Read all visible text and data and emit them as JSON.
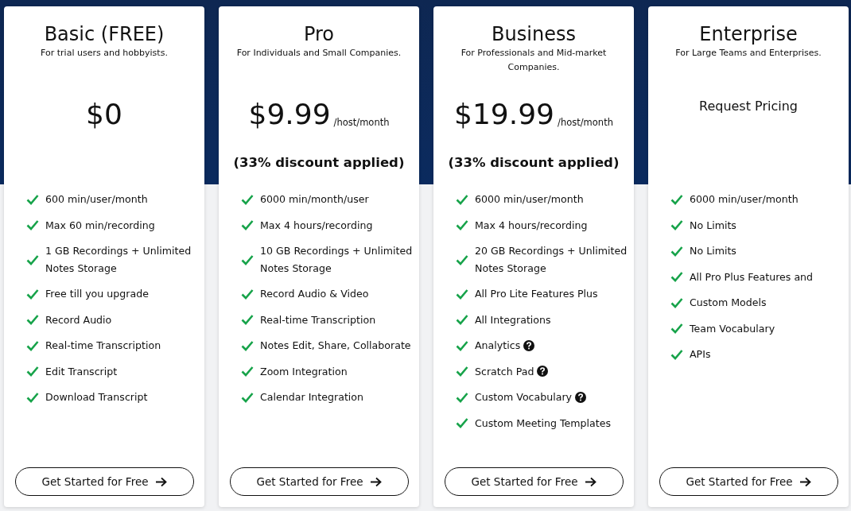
{
  "plans": [
    {
      "name": "Basic (FREE)",
      "subtitle": "For trial users and hobbyists.",
      "price": {
        "kind": "amount",
        "amount": "$0"
      },
      "features": [
        {
          "text": "600 min/user/month",
          "info": false
        },
        {
          "text": "Max 60 min/recording",
          "info": false
        },
        {
          "text": "1 GB Recordings + Unlimited Notes Storage",
          "info": false
        },
        {
          "text": "Free till you upgrade",
          "info": false
        },
        {
          "text": "Record Audio",
          "info": false
        },
        {
          "text": "Real-time Transcription",
          "info": false
        },
        {
          "text": "Edit Transcript",
          "info": false
        },
        {
          "text": "Download Transcript",
          "info": false
        }
      ],
      "button": "Get Started for Free"
    },
    {
      "name": "Pro",
      "subtitle": "For Individuals and Small Companies.",
      "price": {
        "kind": "amount",
        "amount": "$9.99",
        "unit": "/host/month"
      },
      "discount": "(33% discount applied)",
      "features": [
        {
          "text": "6000 min/month/user",
          "info": false
        },
        {
          "text": "Max 4 hours/recording",
          "info": false
        },
        {
          "text": "10 GB Recordings + Unlimited Notes Storage",
          "info": false
        },
        {
          "text": "Record Audio & Video",
          "info": false
        },
        {
          "text": "Real-time Transcription",
          "info": false
        },
        {
          "text": "Notes Edit, Share, Collaborate",
          "info": false
        },
        {
          "text": "Zoom Integration",
          "info": false
        },
        {
          "text": "Calendar Integration",
          "info": false
        }
      ],
      "button": "Get Started for Free"
    },
    {
      "name": "Business",
      "subtitle": "For Professionals and Mid-market Companies.",
      "price": {
        "kind": "amount",
        "amount": "$19.99",
        "unit": "/host/month"
      },
      "discount": "(33% discount applied)",
      "features": [
        {
          "text": "6000 min/user/month",
          "info": false
        },
        {
          "text": "Max 4 hours/recording",
          "info": false
        },
        {
          "text": "20 GB Recordings + Unlimited Notes Storage",
          "info": false
        },
        {
          "text": "All Pro Lite Features Plus",
          "info": false
        },
        {
          "text": "All Integrations",
          "info": false
        },
        {
          "text": "Analytics",
          "info": true
        },
        {
          "text": "Scratch Pad",
          "info": true
        },
        {
          "text": "Custom Vocabulary",
          "info": true
        },
        {
          "text": "Custom Meeting Templates",
          "info": false
        }
      ],
      "button": "Get Started for Free"
    },
    {
      "name": "Enterprise",
      "subtitle": "For Large Teams and Enterprises.",
      "price": {
        "kind": "request",
        "text": "Request Pricing"
      },
      "features": [
        {
          "text": "6000 min/user/month",
          "info": false
        },
        {
          "text": "No Limits",
          "info": false
        },
        {
          "text": "No Limits",
          "info": false
        },
        {
          "text": "All Pro Plus Features and",
          "info": false
        },
        {
          "text": "Custom Models",
          "info": false
        },
        {
          "text": "Team Vocabulary",
          "info": false
        },
        {
          "text": "APIs",
          "info": false
        }
      ],
      "button": "Get Started for Free"
    }
  ]
}
